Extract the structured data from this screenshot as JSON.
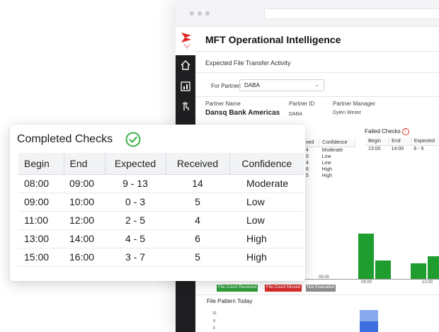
{
  "app": {
    "title": "MFT Operational Intelligence",
    "subtitle": "Expected File Transfer Activity"
  },
  "filter": {
    "partner_label": "For Partner:",
    "partner_value": "DABA"
  },
  "partner_info": {
    "name_label": "Partner Name",
    "name_value": "Dansq Bank Americas",
    "id_label": "Partner ID",
    "id_value": "DABA",
    "manager_label": "Partner Manager",
    "manager_value": "Dylen Winter"
  },
  "background_checks": {
    "headers": [
      "ved",
      "Confidence"
    ],
    "rows": [
      [
        "4",
        "Moderate"
      ],
      [
        "5",
        "Low"
      ],
      [
        "4",
        "Low"
      ],
      [
        "6",
        "High"
      ],
      [
        "5",
        "High"
      ]
    ]
  },
  "failed_checks": {
    "title": "Failed Checks",
    "headers": [
      "Begin",
      "End",
      "Expected"
    ],
    "row": [
      "13:00",
      "14:00",
      "8 - 9"
    ]
  },
  "activity_chart": {
    "x_ticks": [
      "08:00",
      "09:00",
      "12:00"
    ],
    "legend": [
      {
        "label": "File Count Received",
        "color": "#2e9e3a"
      },
      {
        "label": "File Count Missed",
        "color": "#d92b2b"
      },
      {
        "label": "Not Evaluated",
        "color": "#8c8c8c"
      }
    ]
  },
  "pattern": {
    "title": "File Pattern Today",
    "y_ticks": [
      "12",
      "9",
      "6"
    ]
  },
  "completed": {
    "title": "Completed Checks",
    "headers": {
      "begin": "Begin",
      "end": "End",
      "expected": "Expected",
      "received": "Received",
      "confidence": "Confidence"
    },
    "rows": [
      {
        "begin": "08:00",
        "end": "09:00",
        "expected": "9 - 13",
        "received": "14",
        "confidence": "Moderate"
      },
      {
        "begin": "09:00",
        "end": "10:00",
        "expected": "0 - 3",
        "received": "5",
        "confidence": "Low"
      },
      {
        "begin": "11:00",
        "end": "12:00",
        "expected": "2 - 5",
        "received": "4",
        "confidence": "Low"
      },
      {
        "begin": "13:00",
        "end": "14:00",
        "expected": "4 - 5",
        "received": "6",
        "confidence": "High"
      },
      {
        "begin": "15:00",
        "end": "16:00",
        "expected": "3 - 7",
        "received": "5",
        "confidence": "High"
      }
    ]
  },
  "colors": {
    "brand_red": "#e02424",
    "success_green": "#3bb44a",
    "bar_green": "#1f9d2e",
    "pattern_blue": "#3d6fe0"
  }
}
